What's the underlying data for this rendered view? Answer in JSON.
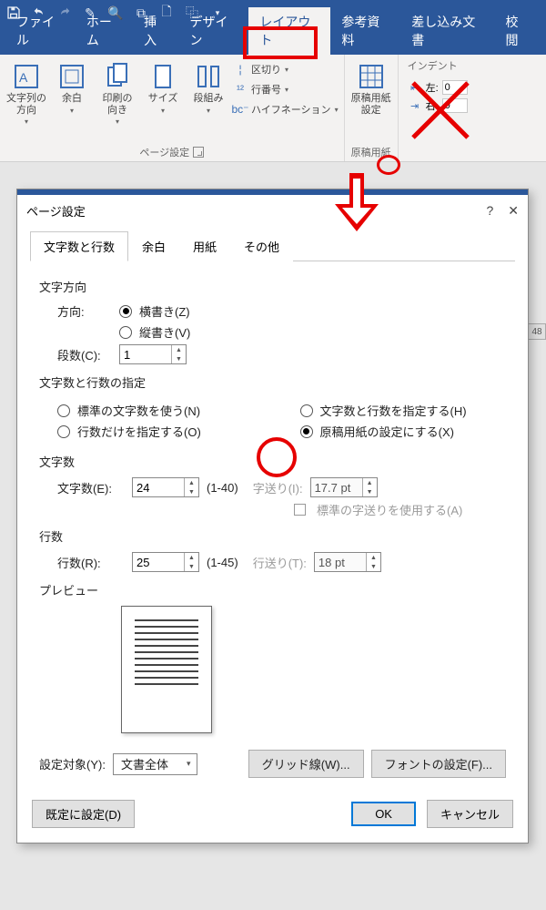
{
  "qa": {
    "save": "保存",
    "undo": "元に戻す",
    "redo": "やり直し"
  },
  "tabs": {
    "file": "ファイル",
    "home": "ホーム",
    "insert": "挿入",
    "design": "デザイン",
    "layout": "レイアウト",
    "reference": "参考資料",
    "mailings": "差し込み文書",
    "review": "校閲"
  },
  "ribbon": {
    "textdir": "文字列の\n方向",
    "margins": "余白",
    "orient": "印刷の\n向き",
    "size": "サイズ",
    "columns": "段組み",
    "breaks": "区切り",
    "linenum": "行番号",
    "hyphen": "ハイフネーション",
    "grouplabel_page": "ページ設定",
    "genkou": "原稿用紙\n設定",
    "grouplabel_genkou": "原稿用紙",
    "indent_title": "インデント",
    "indent_left": "左:",
    "indent_right": "右:",
    "indent_val": "0"
  },
  "dlg": {
    "title": "ページ設定",
    "tabs": {
      "chars": "文字数と行数",
      "margins": "余白",
      "paper": "用紙",
      "other": "その他"
    },
    "dir_section": "文字方向",
    "dir_label": "方向:",
    "dir_h": "横書き(Z)",
    "dir_v": "縦書き(V)",
    "cols_label": "段数(C):",
    "cols_val": "1",
    "spec_section": "文字数と行数の指定",
    "spec_std": "標準の文字数を使う(N)",
    "spec_both": "文字数と行数を指定する(H)",
    "spec_lines": "行数だけを指定する(O)",
    "spec_genkou": "原稿用紙の設定にする(X)",
    "chars_section": "文字数",
    "chars_label": "文字数(E):",
    "chars_val": "24",
    "chars_range": "(1-40)",
    "pitchI_label": "字送り(I):",
    "pitchI_val": "17.7 pt",
    "std_pitch": "標準の字送りを使用する(A)",
    "lines_section": "行数",
    "lines_label": "行数(R):",
    "lines_val": "25",
    "lines_range": "(1-45)",
    "pitchT_label": "行送り(T):",
    "pitchT_val": "18 pt",
    "preview": "プレビュー",
    "applyto_label": "設定対象(Y):",
    "applyto_val": "文書全体",
    "grid_btn": "グリッド線(W)...",
    "font_btn": "フォントの設定(F)...",
    "default_btn": "既定に設定(D)",
    "ok": "OK",
    "cancel": "キャンセル"
  },
  "stub": "48"
}
